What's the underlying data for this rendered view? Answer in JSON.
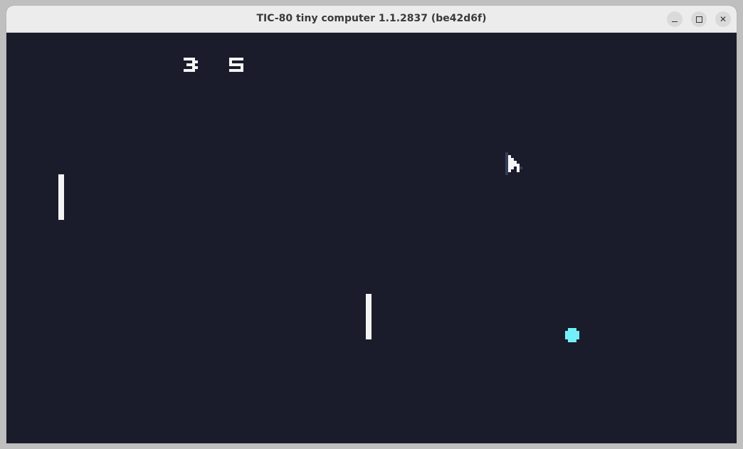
{
  "window": {
    "title": "TIC-80 tiny computer 1.1.2837 (be42d6f)",
    "controls": {
      "minimize_icon": "minimize-icon",
      "maximize_icon": "maximize-icon",
      "close_icon": "close-icon"
    }
  },
  "game": {
    "background_color": "#1a1c2c",
    "score_left": "3",
    "score_right": "5",
    "ball_color": "#73eff7",
    "paddle_color": "#f4f4f4"
  }
}
